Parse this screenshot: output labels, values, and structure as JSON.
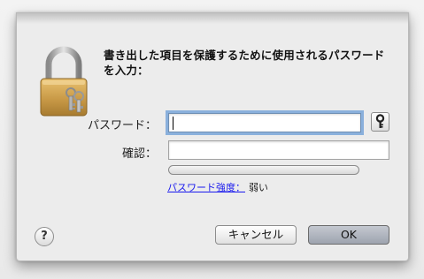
{
  "dialog": {
    "message": "書き出した項目を保護するために使用されるパスワードを入力：",
    "password_label": "パスワード：",
    "password_value": "",
    "verify_label": "確認：",
    "verify_value": "",
    "strength_link": "パスワード強度：",
    "strength_value": "弱い",
    "strength_level": 0,
    "help_label": "?",
    "cancel_label": "キャンセル",
    "ok_label": "OK",
    "icons": {
      "lock": "lock-with-keys-icon",
      "key": "key-icon",
      "help": "help-icon"
    }
  }
}
